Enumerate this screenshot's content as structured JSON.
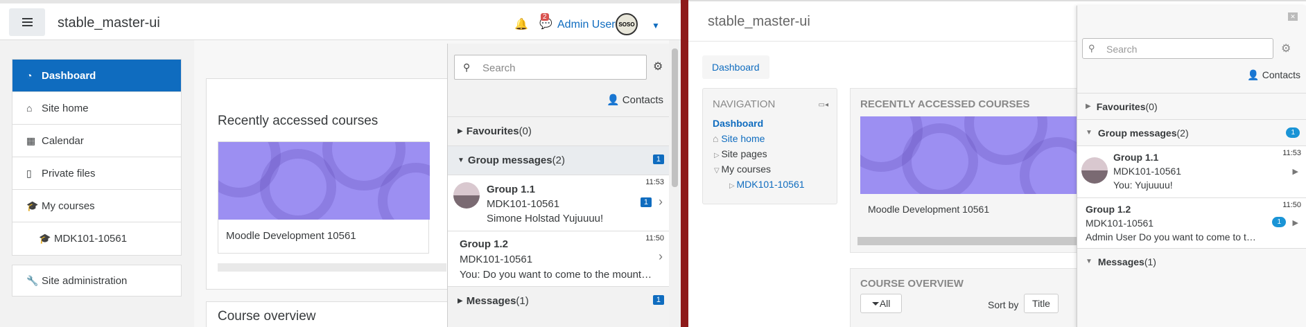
{
  "left": {
    "navbar": {
      "site_name": "stable_master-ui",
      "user_name": "Admin User",
      "avatar_text": "SOSO",
      "message_count": "2"
    },
    "nav": {
      "items": [
        {
          "label": "Dashboard",
          "icon": "dashboard-icon"
        },
        {
          "label": "Site home",
          "icon": "home-icon"
        },
        {
          "label": "Calendar",
          "icon": "calendar-icon"
        },
        {
          "label": "Private files",
          "icon": "file-icon"
        },
        {
          "label": "My courses",
          "icon": "graduation-cap-icon"
        },
        {
          "label": "MDK101-10561",
          "icon": "graduation-cap-icon"
        }
      ],
      "admin": {
        "label": "Site administration",
        "icon": "wrench-icon"
      }
    },
    "main": {
      "recent_title": "Recently accessed courses",
      "course_name": "Moodle Development 10561",
      "overview_title": "Course overview"
    },
    "drawer": {
      "search_placeholder": "Search",
      "contacts": "Contacts",
      "favourites": {
        "label": "Favourites",
        "count": "(0)"
      },
      "group_messages": {
        "label": "Group messages",
        "count": "(2)",
        "badge": "1"
      },
      "conversations": [
        {
          "title": "Group 1.1",
          "course": "MDK101-10561",
          "last": "Simone Holstad Yujuuuu!",
          "time": "11:53",
          "unread": "1"
        },
        {
          "title": "Group 1.2",
          "course": "MDK101-10561",
          "last": "You: Do you want to come to the mount…",
          "time": "11:50"
        }
      ],
      "messages": {
        "label": "Messages",
        "count": "(1)",
        "badge": "1"
      }
    }
  },
  "right": {
    "site_name": "stable_master-ui",
    "breadcrumb": "Dashboard",
    "navigation": {
      "heading": "Navigation",
      "dashboard": "Dashboard",
      "site_home": "Site home",
      "site_pages": "Site pages",
      "my_courses": "My courses",
      "course": "MDK101-10561"
    },
    "recent": {
      "heading": "Recently accessed courses",
      "course_name": "Moodle Development 10561"
    },
    "overview": {
      "heading": "Course overview",
      "all": "All",
      "sort_by": "Sort by",
      "title": "Title"
    },
    "drawer": {
      "search_placeholder": "Search",
      "contacts": "Contacts",
      "favourites": {
        "label": "Favourites",
        "count": "(0)"
      },
      "group_messages": {
        "label": "Group messages",
        "count": "(2)",
        "badge": "1"
      },
      "conversations": [
        {
          "title": "Group 1.1",
          "course": "MDK101-10561",
          "last": "You: Yujuuuu!",
          "time": "11:53"
        },
        {
          "title": "Group 1.2",
          "course": "MDK101-10561",
          "last": "Admin User Do you want to come to t…",
          "time": "11:50",
          "unread": "1"
        }
      ],
      "messages": {
        "label": "Messages",
        "count": "(1)"
      }
    }
  }
}
